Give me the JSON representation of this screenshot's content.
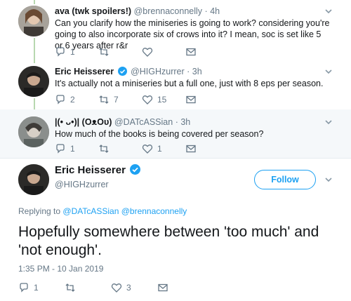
{
  "replies": [
    {
      "name": "ava (twk spoilers!)",
      "handle": "@brennaconnelly",
      "dot": "·",
      "time": "4h",
      "text": "Can you clarify how the miniseries is going to work? considering you're going to also incorporate six of crows into it? I mean, soc is set like 5 or 6 years after r&r",
      "verified": false,
      "replies": "1",
      "retweets": "",
      "likes": ""
    },
    {
      "name": "Eric Heisserer",
      "handle": "@HIGHzurrer",
      "dot": "·",
      "time": "3h",
      "text": "It's actually not a miniseries but a full one, just with 8 eps per season.",
      "verified": true,
      "replies": "2",
      "retweets": "7",
      "likes": "15"
    },
    {
      "name": "|(• ᴗ•)| (O⁠ᴥO⁠υ)",
      "handle": "@DATcASSian",
      "dot": "·",
      "time": "3h",
      "text": "How much of the books is being covered per season?",
      "verified": false,
      "replies": "1",
      "retweets": "",
      "likes": "1"
    }
  ],
  "main_tweet": {
    "name": "Eric Heisserer",
    "handle": "@HIGHzurrer",
    "follow_label": "Follow",
    "replying_prefix": "Replying to",
    "replying_to": "@DATcASSian @brennaconnelly",
    "text": "Hopefully somewhere between 'too much' and 'not enough'.",
    "timestamp": "1:35 PM - 10 Jan 2019",
    "replies": "1",
    "retweets": "",
    "likes": "3"
  },
  "colors": {
    "accent": "#1da1f2",
    "muted": "#657786",
    "thread_line": "#b8d8b0",
    "shaded_bg": "#f5f8fa"
  }
}
